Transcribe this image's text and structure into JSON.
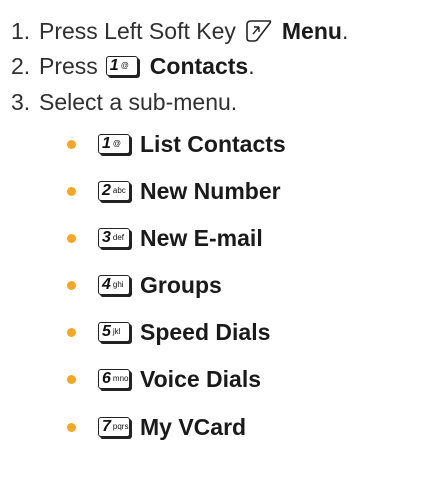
{
  "steps": [
    {
      "num": "1.",
      "text": "Press Left Soft Key",
      "icon": "left-soft-key-icon",
      "bold": "Menu",
      "tail": "."
    },
    {
      "num": "2.",
      "text": "Press",
      "key": {
        "digit": "1",
        "sub": "@"
      },
      "bold": "Contacts",
      "tail": "."
    },
    {
      "num": "3.",
      "text": "Select a sub-menu.",
      "bold": "",
      "tail": ""
    }
  ],
  "submenu": [
    {
      "key": {
        "digit": "1",
        "sub": "@"
      },
      "label": "List Contacts"
    },
    {
      "key": {
        "digit": "2",
        "sub": "abc"
      },
      "label": "New Number"
    },
    {
      "key": {
        "digit": "3",
        "sub": "def"
      },
      "label": "New E-mail"
    },
    {
      "key": {
        "digit": "4",
        "sub": "ghi"
      },
      "label": "Groups"
    },
    {
      "key": {
        "digit": "5",
        "sub": "jkl"
      },
      "label": "Speed Dials"
    },
    {
      "key": {
        "digit": "6",
        "sub": "mno"
      },
      "label": "Voice Dials"
    },
    {
      "key": {
        "digit": "7",
        "sub": "pqrs"
      },
      "label": "My VCard"
    }
  ],
  "colors": {
    "bullet": "#f5a623"
  }
}
